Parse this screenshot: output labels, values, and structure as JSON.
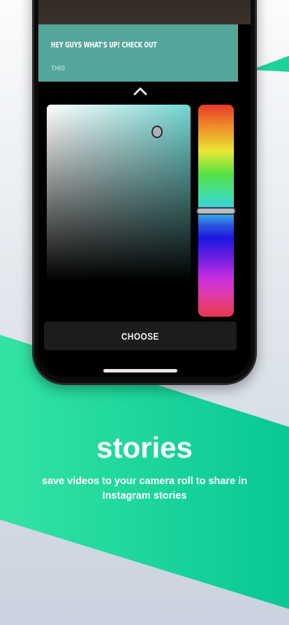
{
  "caption": {
    "line1": "HEY GUYS WHAT'S UP! CHECK OUT",
    "line2": "THIS"
  },
  "color_picker": {
    "selected_hue_color": "#73d6d2",
    "hue_level": 0.5
  },
  "choose_button": {
    "label": "CHOOSE"
  },
  "promo": {
    "headline": "stories",
    "subtitle": "save videos to your camera roll to share in Instagram stories"
  },
  "colors": {
    "accent_green": "#2fd99a",
    "caption_bg": "#55a69a"
  },
  "icons": {
    "collapse": "chevron-up-icon"
  }
}
